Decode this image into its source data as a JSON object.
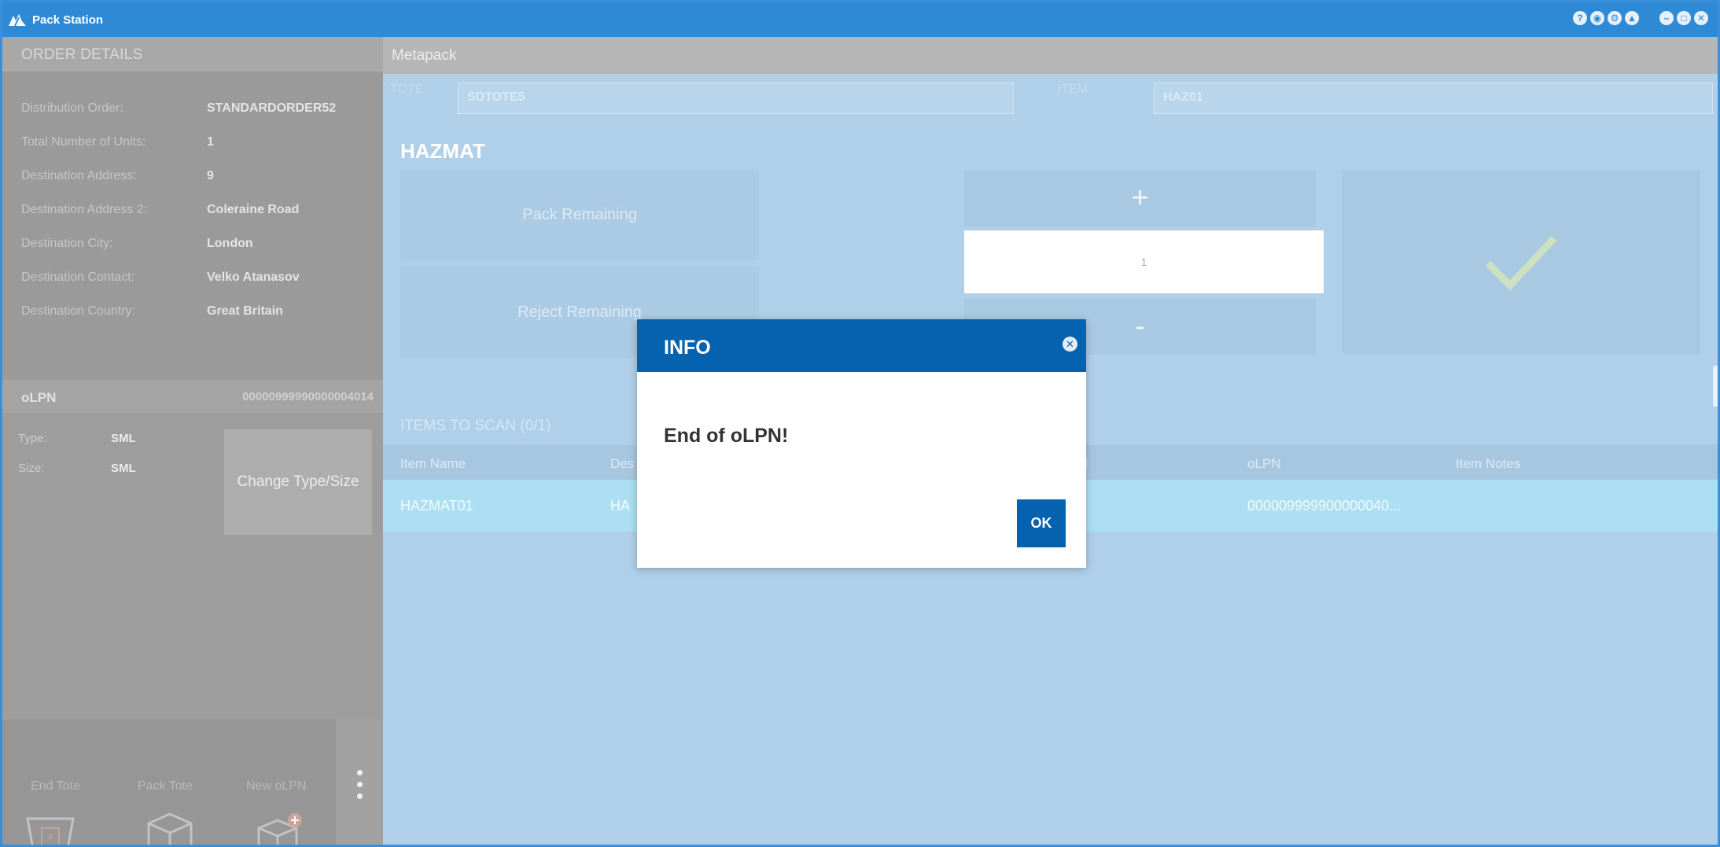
{
  "window": {
    "title": "Pack Station",
    "title_icons": [
      "help-icon",
      "location-icon",
      "settings-icon",
      "up-arrow-icon",
      "minimize-icon",
      "restore-icon",
      "close-icon"
    ]
  },
  "order_details": {
    "header": "ORDER DETAILS",
    "rows": [
      {
        "label": "Distribution Order:",
        "value": "STANDARDORDER52"
      },
      {
        "label": "Total Number of Units:",
        "value": "1"
      },
      {
        "label": "Destination Address:",
        "value": "9"
      },
      {
        "label": "Destination Address 2:",
        "value": "Coleraine Road"
      },
      {
        "label": "Destination City:",
        "value": "London"
      },
      {
        "label": "Destination Contact:",
        "value": "Velko Atanasov"
      },
      {
        "label": "Destination Country:",
        "value": "Great Britain"
      }
    ]
  },
  "olpn": {
    "label": "oLPN",
    "value": "00000999990000004014",
    "type_label": "Type:",
    "type_value": "SML",
    "size_label": "Size:",
    "size_value": "SML",
    "change_button": "Change Type/Size"
  },
  "bottom_actions": [
    {
      "label": "End Tote",
      "icon": "end-tote-icon"
    },
    {
      "label": "Pack Tote",
      "icon": "pack-tote-icon"
    },
    {
      "label": "New oLPN",
      "icon": "new-olpn-icon"
    }
  ],
  "main": {
    "section_title": "Metapack",
    "tote_label": "TOTE",
    "tote_value": "SDTOTE5",
    "item_label": "ITEM",
    "item_value": "HAZ01",
    "item_heading": "HAZMAT",
    "pack_remaining": "Pack Remaining",
    "reject_remaining": "Reject Remaining",
    "plus": "+",
    "quantity": "1",
    "minus": "-",
    "items_to_scan": "ITEMS TO SCAN (0/1)",
    "columns": [
      "Item Name",
      "Des",
      "cked",
      "oLPN",
      "Item Notes"
    ],
    "rows": [
      {
        "item_name": "HAZMAT01",
        "description": "HA",
        "olpn": "000009999900000040..."
      }
    ]
  },
  "dialog": {
    "title": "INFO",
    "message": "End of oLPN!",
    "ok_label": "OK"
  },
  "colors": {
    "titlebar": "#2f8ad6",
    "dialog_header": "#0562ae",
    "main_bg": "#b0d0e9",
    "selected_row": "#acdff2"
  }
}
